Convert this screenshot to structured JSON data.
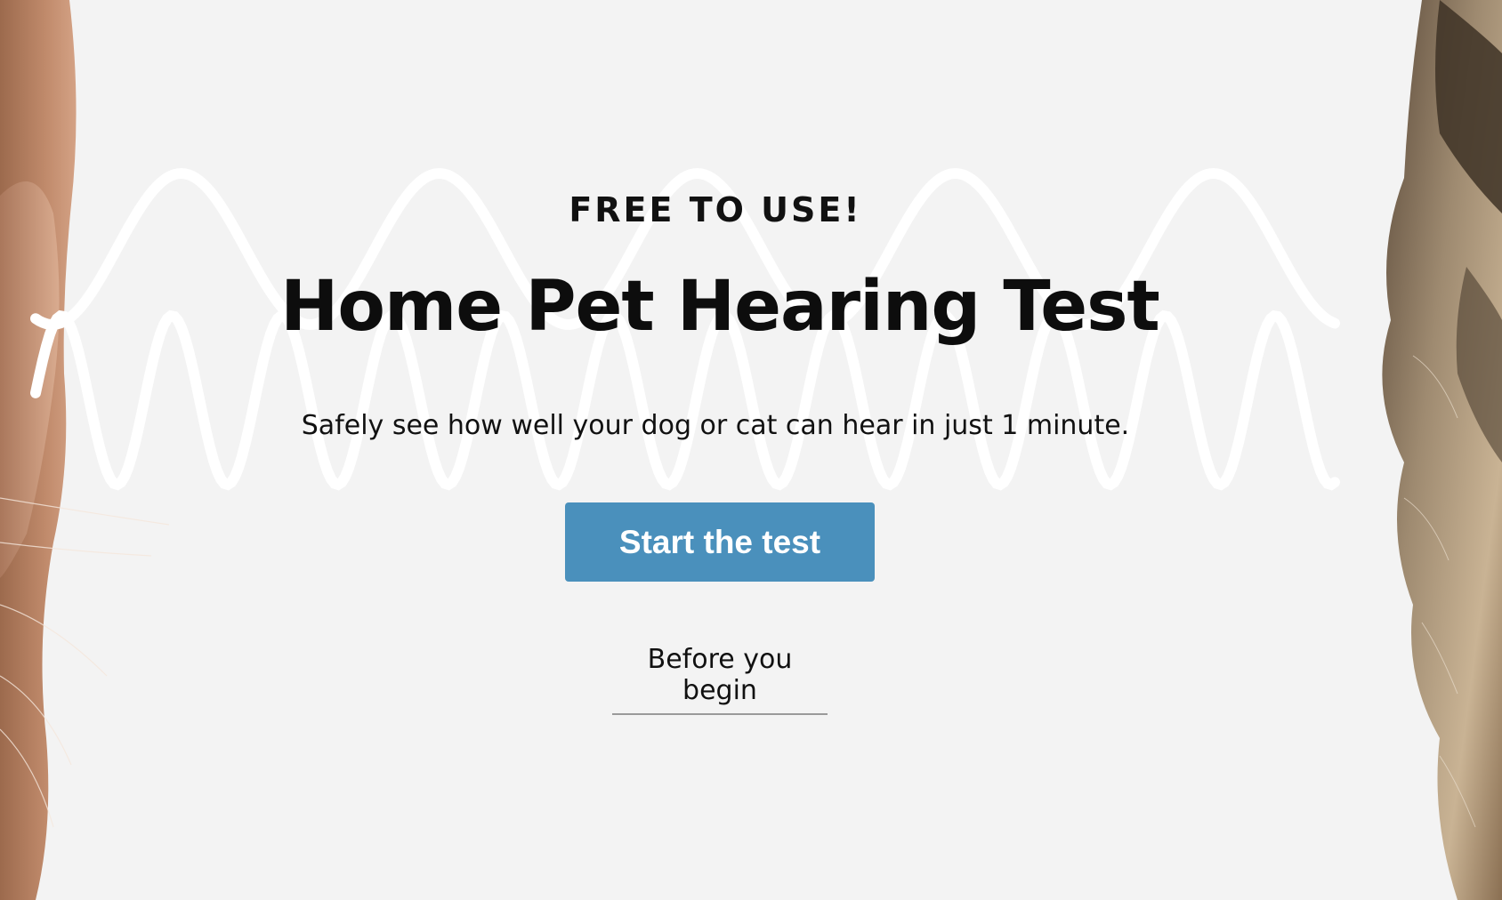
{
  "hero": {
    "eyebrow": "FREE TO USE!",
    "title": "Home Pet Hearing Test",
    "subtitle": "Safely see how well your dog or cat can hear in just 1 minute.",
    "cta_label": "Start the test",
    "secondary_link": "Before you begin"
  },
  "colors": {
    "background": "#f3f3f3",
    "cta_background": "#4a90bc",
    "cta_text": "#ffffff",
    "text": "#111111",
    "wave": "#ffffff"
  },
  "icons": {
    "left_image": "cat-ear-photo",
    "right_image": "dog-ear-photo",
    "background_graphic": "sound-wave-graphic"
  }
}
